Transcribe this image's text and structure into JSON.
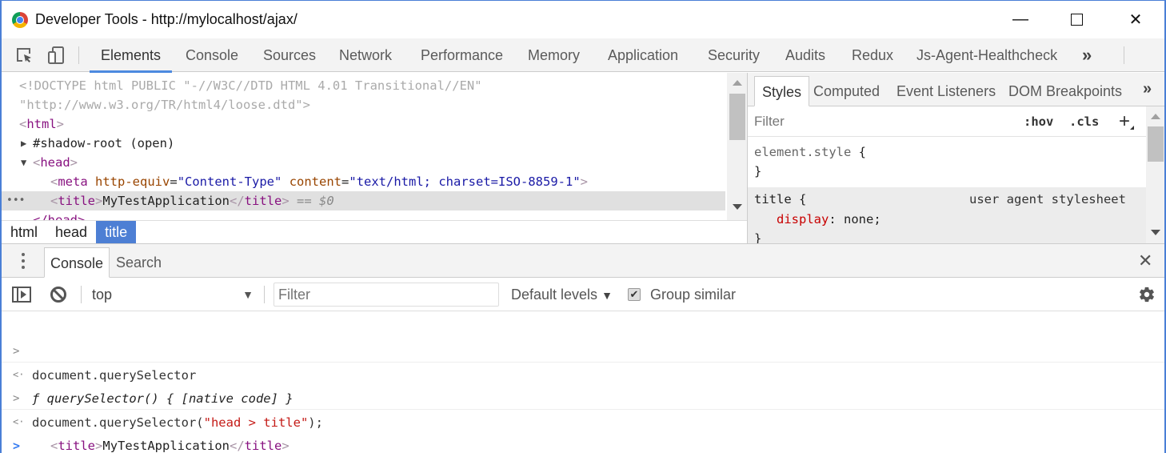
{
  "window": {
    "title": "Developer Tools - http://mylocalhost/ajax/",
    "controls": {
      "minimize": "—",
      "maximize": "☐",
      "close": "✕"
    }
  },
  "toolbar": {
    "icons": [
      "inspect-element-icon",
      "device-toolbar-icon"
    ],
    "tabs": [
      {
        "label": "Elements",
        "active": true
      },
      {
        "label": "Console"
      },
      {
        "label": "Sources"
      },
      {
        "label": "Network"
      },
      {
        "label": "Performance"
      },
      {
        "label": "Memory"
      },
      {
        "label": "Application"
      },
      {
        "label": "Security"
      },
      {
        "label": "Audits"
      },
      {
        "label": "Redux"
      },
      {
        "label": "Js-Agent-Healthcheck"
      }
    ],
    "overflow": "»",
    "menu": "⋮"
  },
  "elements": {
    "lines": [
      {
        "text": "<!DOCTYPE html PUBLIC \"-//W3C//DTD HTML 4.01 Transitional//EN\""
      },
      {
        "text": "\"http://www.w3.org/TR/html4/loose.dtd\">"
      },
      {
        "open": "<",
        "tag": "html",
        "close": ">"
      },
      {
        "toggle": "▶",
        "text": "#shadow-root (open)"
      },
      {
        "toggle": "▼",
        "open": "<",
        "tag": "head",
        "close": ">"
      },
      {
        "meta_open": "<",
        "meta_tag": "meta",
        "attr1": "http-equiv",
        "eq1": "=",
        "val1": "\"Content-Type\"",
        "attr2": "content",
        "eq2": "=",
        "val2": "\"text/html; charset=ISO-8859-1\"",
        "meta_close": ">"
      },
      {
        "selected": true,
        "dots": "•••",
        "open": "<",
        "tag": "title",
        "mid": ">",
        "text": "MyTestApplication",
        "close_open": "</",
        "close_tag": "title",
        "close": ">",
        "eq": " == $0"
      },
      {
        "text": "</head>"
      }
    ]
  },
  "breadcrumb": [
    {
      "label": "html"
    },
    {
      "label": "head"
    },
    {
      "label": "title",
      "active": true
    }
  ],
  "styles": {
    "tabs": [
      {
        "label": "Styles",
        "active": true
      },
      {
        "label": "Computed"
      },
      {
        "label": "Event Listeners"
      },
      {
        "label": "DOM Breakpoints"
      }
    ],
    "overflow": "»",
    "filter_placeholder": "Filter",
    "hov": ":hov",
    "cls": ".cls",
    "add": "+",
    "rules": [
      {
        "selector": "element.style",
        "open": " {",
        "close": "}"
      },
      {
        "selector": "title",
        "open": " {",
        "source": "user agent stylesheet",
        "property": "display",
        "colon": ": ",
        "value": "none;",
        "close": "}"
      }
    ]
  },
  "drawer": {
    "tabs": [
      {
        "label": "Console",
        "active": true
      },
      {
        "label": "Search"
      }
    ],
    "close": "✕"
  },
  "console_toolbar": {
    "context": "top",
    "context_arrow": "▼",
    "filter_placeholder": "Filter",
    "levels": "Default levels",
    "levels_arrow": "▼",
    "group_similar": "Group similar",
    "group_similar_checked": true,
    "checkmark": "✔"
  },
  "console": {
    "messages": [
      {
        "prompt": ">",
        "text": "document.querySelector"
      },
      {
        "prompt": "<·",
        "f": "ƒ",
        "text": " querySelector() { [native code] }"
      },
      {
        "prompt": ">",
        "text_pre": "document.querySelector(",
        "string": "\"head > title\"",
        "text_post": ");"
      },
      {
        "prompt": "<·",
        "open": "<",
        "tag": "title",
        "mid": ">",
        "text": "MyTestApplication",
        "close_open": "</",
        "close_tag": "title",
        "close": ">"
      }
    ],
    "input_prompt": ">"
  }
}
